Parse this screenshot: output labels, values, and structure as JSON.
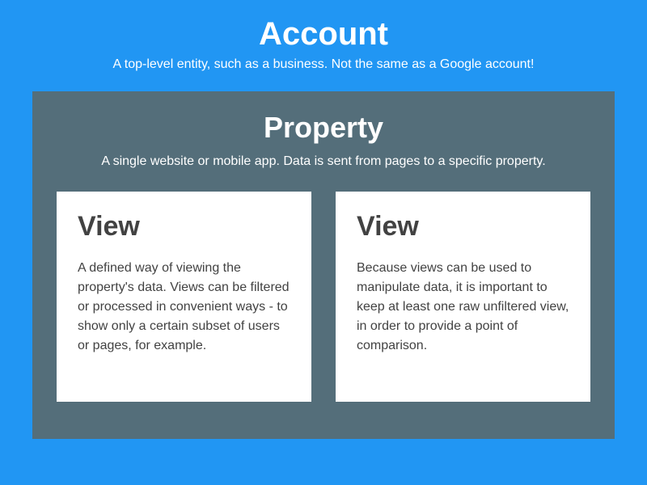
{
  "account": {
    "title": "Account",
    "description": "A top-level entity, such as a business. Not the same as a Google account!"
  },
  "property": {
    "title": "Property",
    "description": "A single website or mobile app. Data is sent from pages to a specific property."
  },
  "views": [
    {
      "title": "View",
      "description": "A defined way of viewing the property's data. Views can be filtered or processed in convenient ways - to show only a certain subset of users or pages, for example."
    },
    {
      "title": "View",
      "description": "Because views can be used to manipulate data, it is important to keep at least one raw unfiltered view, in order to provide a point of comparison."
    }
  ]
}
